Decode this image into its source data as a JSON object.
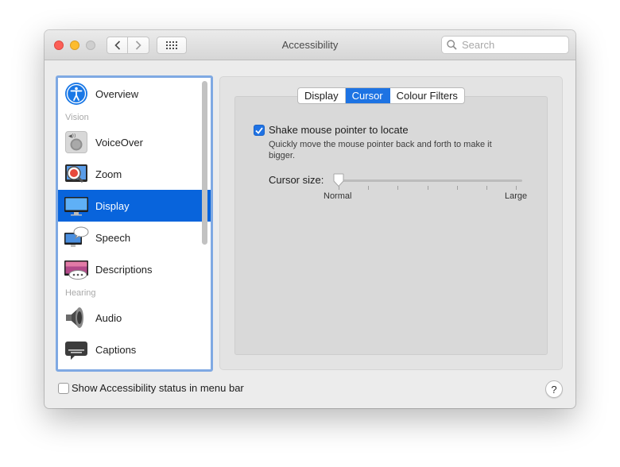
{
  "window": {
    "title": "Accessibility"
  },
  "search": {
    "placeholder": "Search"
  },
  "sidebar": {
    "items": [
      {
        "label": "Overview",
        "icon": "accessibility-icon"
      },
      {
        "section": "Vision"
      },
      {
        "label": "VoiceOver",
        "icon": "voiceover-icon"
      },
      {
        "label": "Zoom",
        "icon": "zoom-icon"
      },
      {
        "label": "Display",
        "icon": "display-icon",
        "selected": true
      },
      {
        "label": "Speech",
        "icon": "speech-icon"
      },
      {
        "label": "Descriptions",
        "icon": "descriptions-icon"
      },
      {
        "section": "Hearing"
      },
      {
        "label": "Audio",
        "icon": "speaker-icon"
      },
      {
        "label": "Captions",
        "icon": "captions-icon"
      }
    ]
  },
  "tabs": [
    {
      "label": "Display",
      "active": false
    },
    {
      "label": "Cursor",
      "active": true
    },
    {
      "label": "Colour Filters",
      "active": false
    }
  ],
  "cursor": {
    "shake": {
      "label": "Shake mouse pointer to locate",
      "checked": true,
      "description": "Quickly move the mouse pointer back and forth to make it bigger."
    },
    "size": {
      "label": "Cursor size:",
      "min_label": "Normal",
      "max_label": "Large",
      "value": 0
    }
  },
  "footer": {
    "status_label": "Show Accessibility status in menu bar",
    "status_checked": false,
    "help_label": "?"
  },
  "colors": {
    "accent": "#0864dc",
    "close": "#fc5f57",
    "minimize": "#fdbc2e"
  }
}
